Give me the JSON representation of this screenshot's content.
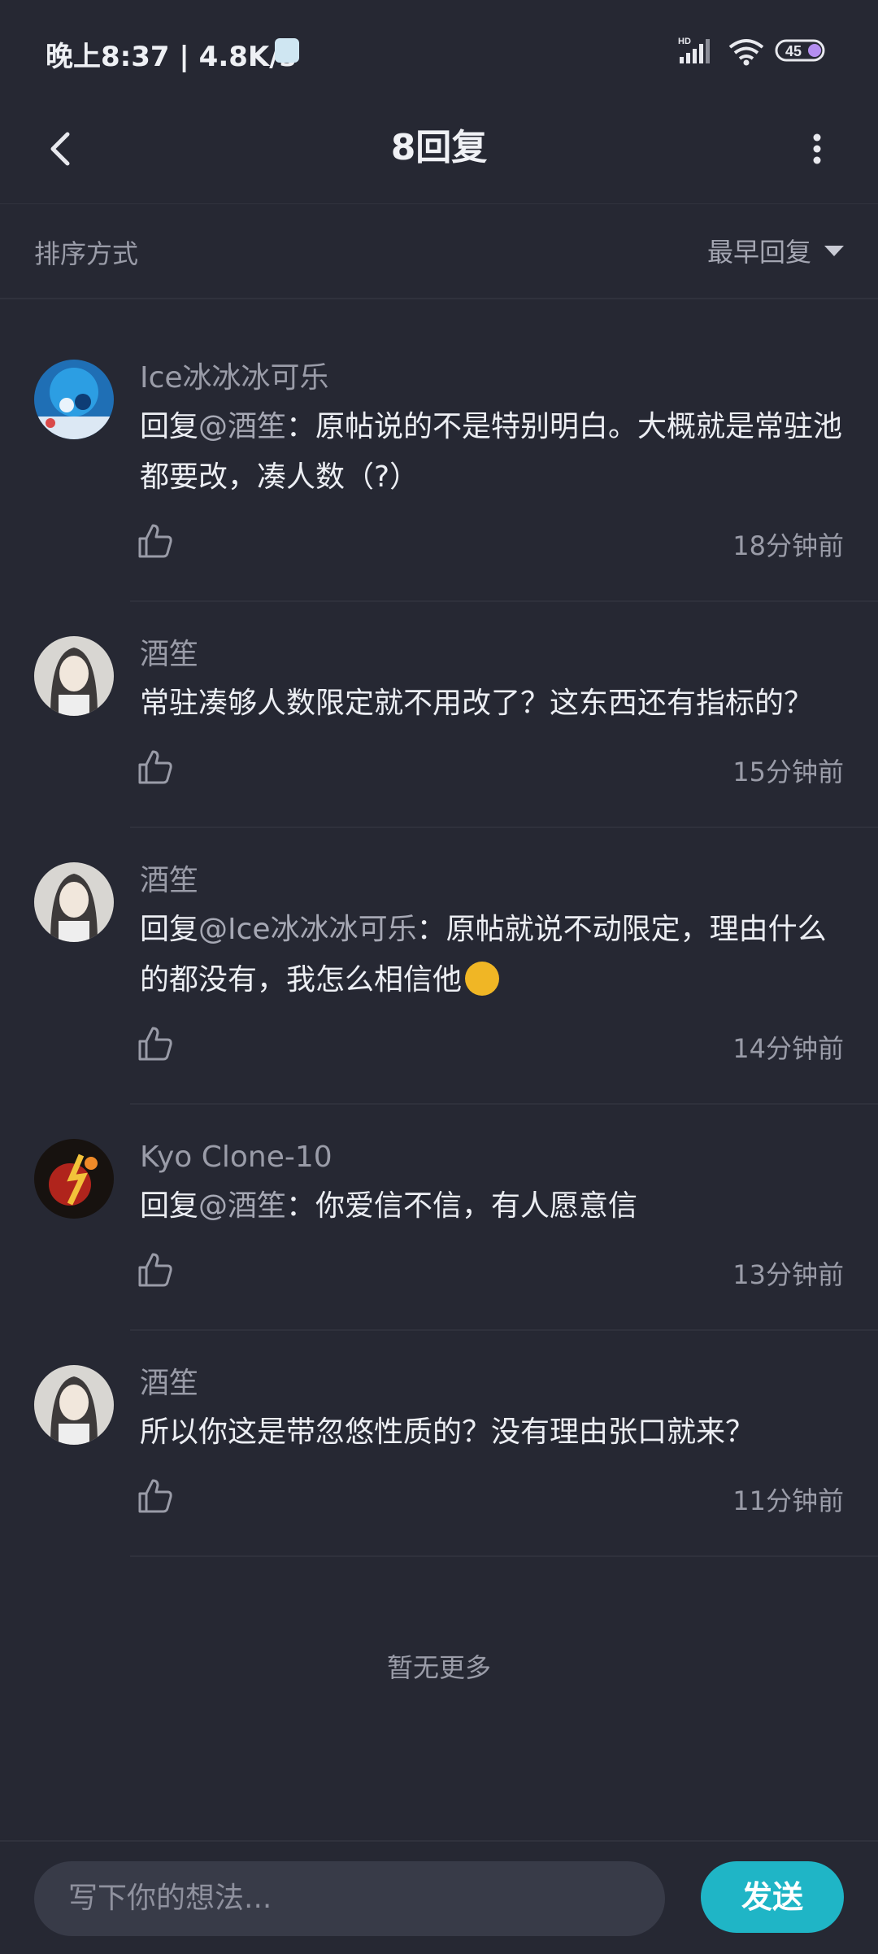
{
  "status": {
    "time": "晚上8:37 | 4.8K/s",
    "battery": "45"
  },
  "header": {
    "title": "8回复"
  },
  "sort": {
    "label": "排序方式",
    "value": "最早回复"
  },
  "replies": [
    {
      "username": "Ice冰冰冰可乐",
      "prefix": "回复",
      "mention": "@酒笙",
      "text": "：原帖说的不是特别明白。大概就是常驻池都要改，凑人数（?）",
      "time": "18分钟前"
    },
    {
      "username": "酒笙",
      "prefix": "",
      "mention": "",
      "text": "常驻凑够人数限定就不用改了？这东西还有指标的？",
      "time": "15分钟前"
    },
    {
      "username": "酒笙",
      "prefix": "回复",
      "mention": "@Ice冰冰冰可乐",
      "text": "：原帖就说不动限定，理由什么的都没有，我怎么相信他",
      "time": "14分钟前"
    },
    {
      "username": "Kyo Clone-10",
      "prefix": "回复",
      "mention": "@酒笙",
      "text": "：你爱信不信，有人愿意信",
      "time": "13分钟前"
    },
    {
      "username": "酒笙",
      "prefix": "",
      "mention": "",
      "text": "所以你这是带忽悠性质的？没有理由张口就来？",
      "time": "11分钟前"
    }
  ],
  "no_more": "暂无更多",
  "composer": {
    "placeholder": "写下你的想法...",
    "send_label": "发送"
  },
  "colors": {
    "background": "#262833",
    "accent": "#1fb5c6"
  },
  "icons": [
    "back-arrow-icon",
    "more-vertical-icon",
    "caret-down-icon",
    "thumbs-up-icon",
    "signal-icon",
    "wifi-icon",
    "battery-icon"
  ]
}
